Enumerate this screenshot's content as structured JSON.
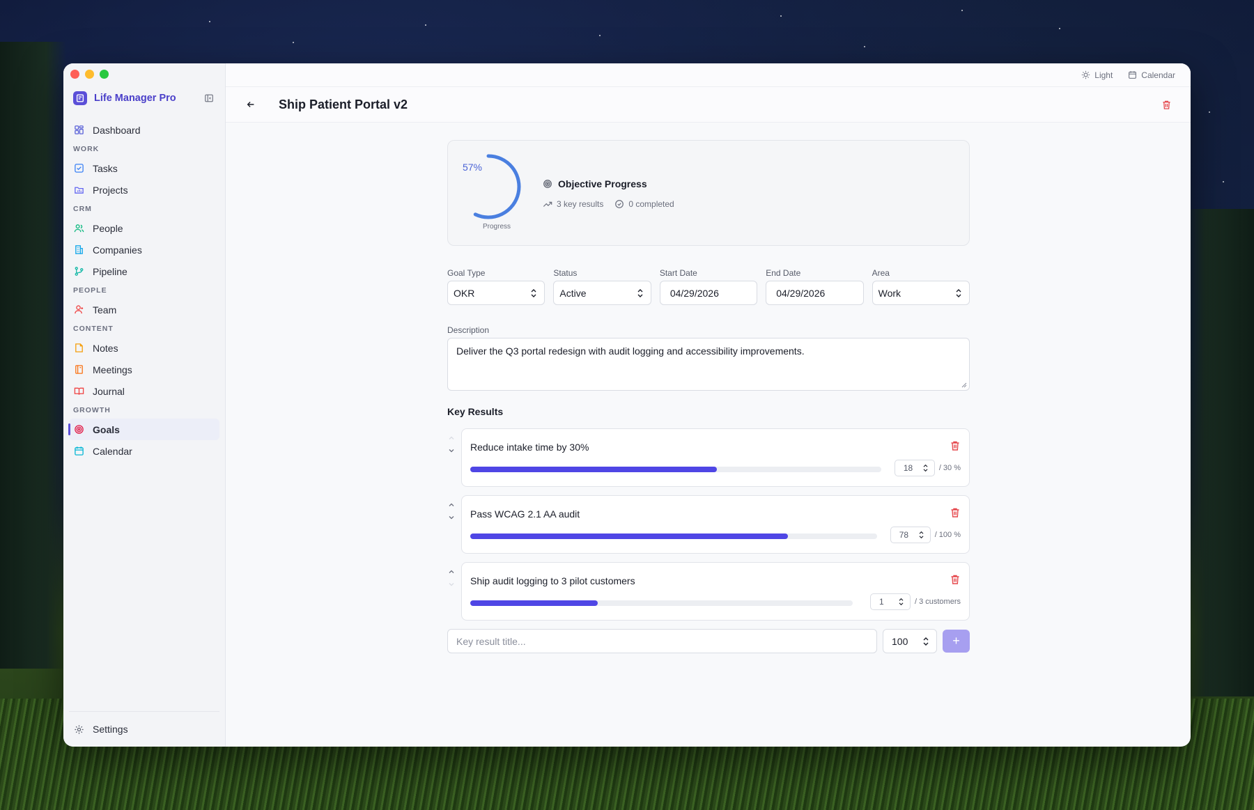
{
  "app": {
    "name": "Life Manager Pro"
  },
  "topbar": {
    "theme_label": "Light",
    "calendar_label": "Calendar"
  },
  "sidebar": {
    "dashboard": "Dashboard",
    "sections": {
      "work": "WORK",
      "crm": "CRM",
      "people": "PEOPLE",
      "content": "CONTENT",
      "growth": "GROWTH"
    },
    "items": {
      "tasks": "Tasks",
      "projects": "Projects",
      "people": "People",
      "companies": "Companies",
      "pipeline": "Pipeline",
      "team": "Team",
      "notes": "Notes",
      "meetings": "Meetings",
      "journal": "Journal",
      "goals": "Goals",
      "calendar": "Calendar"
    },
    "settings": "Settings",
    "active": "goals"
  },
  "header": {
    "title": "Ship Patient Portal v2"
  },
  "progress": {
    "percent_label": "57%",
    "percent_value": 57,
    "caption": "Progress",
    "title": "Objective Progress",
    "key_results_label": "3 key results",
    "completed_label": "0 completed"
  },
  "fields": {
    "goal_type": {
      "label": "Goal Type",
      "value": "OKR"
    },
    "status": {
      "label": "Status",
      "value": "Active"
    },
    "start_date": {
      "label": "Start Date",
      "value": "04/29/2026"
    },
    "end_date": {
      "label": "End Date",
      "value": "04/29/2026"
    },
    "area": {
      "label": "Area",
      "value": "Work"
    }
  },
  "description": {
    "label": "Description",
    "value": "Deliver the Q3 portal redesign with audit logging and accessibility improvements."
  },
  "key_results": {
    "title": "Key Results",
    "items": [
      {
        "name": "Reduce intake time by 30%",
        "current": "18",
        "target_label": "/ 30 %",
        "fraction": 0.6
      },
      {
        "name": "Pass WCAG 2.1 AA audit",
        "current": "78",
        "target_label": "/ 100 %",
        "fraction": 0.78
      },
      {
        "name": "Ship audit logging to 3 pilot customers",
        "current": "1",
        "target_label": "/ 3 customers",
        "fraction": 0.333
      }
    ]
  },
  "add_key_result": {
    "placeholder": "Key result title...",
    "target_value": "100",
    "button_label": "+"
  },
  "colors": {
    "accent": "#4f46e5",
    "brand": "#5b4fd8",
    "danger": "#e5484d",
    "ring": "#4a7fe0"
  }
}
